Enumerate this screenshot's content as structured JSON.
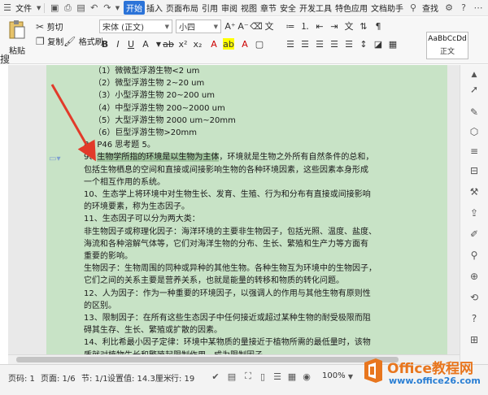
{
  "menubar": {
    "file_label": "文件",
    "tabs": [
      "开始",
      "插入",
      "页面布局",
      "引用",
      "审阅",
      "视图",
      "章节",
      "安全",
      "开发工具",
      "特色应用",
      "文档助手"
    ],
    "active_tab": "开始",
    "search_label": "查找"
  },
  "ribbon": {
    "paste_label": "粘贴",
    "cut_label": "剪切",
    "copy_label": "复制",
    "format_painter_label": "格式刷",
    "font_family": "宋体 (正文)",
    "font_size": "小四",
    "style_preview": "AaBbCcDd",
    "style_name": "正文"
  },
  "left_fragment": "搜",
  "document": {
    "lines": [
      {
        "text": "（1）微微型浮游生物<2 um",
        "indent": true
      },
      {
        "text": "（2）微型浮游生物 2~20 um",
        "indent": true
      },
      {
        "text": "（3）小型浮游生物 20~200 um",
        "indent": true
      },
      {
        "text": "（4）中型浮游生物 200~2000 um",
        "indent": true
      },
      {
        "text": "（5）大型浮游生物 2000 um~20mm",
        "indent": true
      },
      {
        "text": "（6）巨型浮游生物>20mm",
        "indent": true
      },
      {
        "text": "8、P46 思考题 5。",
        "indent": false
      },
      {
        "text": "",
        "indent": false
      },
      {
        "text": "包括生物栖息的空间和直接或间接影响生物的各种环境因素，这些因素本身形成",
        "indent": false
      },
      {
        "text": "一个相互作用的系统。",
        "indent": false
      },
      {
        "text": "10、生态学上将环境中对生物生长、发育、生殖、行为和分布有直接或间接影响",
        "indent": false
      },
      {
        "text": "的环境要素，称为生态因子。",
        "indent": false
      },
      {
        "text": "11、生态因子可以分为两大类：",
        "indent": false
      },
      {
        "text": "非生物因子或称理化因子：海洋环境的主要非生物因子，包括光照、温度、盐度、",
        "indent": false
      },
      {
        "text": "海流和各种溶解气体等，它们对海洋生物的分布、生长、繁殖和生产力等方面有",
        "indent": false
      },
      {
        "text": "重要的影响。",
        "indent": false
      },
      {
        "text": "生物因子：生物周围的同种或异种的其他生物。各种生物互为环境中的生物因子，",
        "indent": false
      },
      {
        "text": "它们之间的关系主要是营养关系，也就是能量的转移和物质的转化问题。",
        "indent": false
      },
      {
        "text": "12、人为因子：作为一种重要的环境因子，以强调人的作用与其他生物有原则性",
        "indent": false
      },
      {
        "text": "的区别。",
        "indent": false
      },
      {
        "text": "13、限制因子：在所有这些生态因子中任何接近或超过某种生物的耐受极限而阻",
        "indent": false
      },
      {
        "text": "碍其生存、生长、繁殖或扩散的因素。",
        "indent": false
      },
      {
        "text": "14、利比希最小因子定律：环境中某物质的量接近于植物所需的最低量时，该物",
        "indent": false
      },
      {
        "text": "质就对植物生长和繁殖起限制作用，成为限制因子。",
        "indent": false
      }
    ],
    "line9_prefix": "9、",
    "line9_highlight": "生物学所指的环境是以生物为主体",
    "line9_rest": "，环境就是生物之外所有自然条件的总和，"
  },
  "statusbar": {
    "page": "页码: 1",
    "pages": "页面: 1/6",
    "section": "节: 1/1",
    "position": "设置值: 14.3厘米",
    "row": "行: 19",
    "zoom": "100%"
  },
  "watermark": {
    "title": "Office教程网",
    "url": "www.office26.com"
  },
  "colors": {
    "page_bg": "#c8e3c6",
    "highlight": "#9fc39c",
    "accent": "#2b73d8",
    "arrow": "#e23a2a",
    "watermark_orange": "#e8761e",
    "watermark_blue": "#2a7fd4"
  }
}
